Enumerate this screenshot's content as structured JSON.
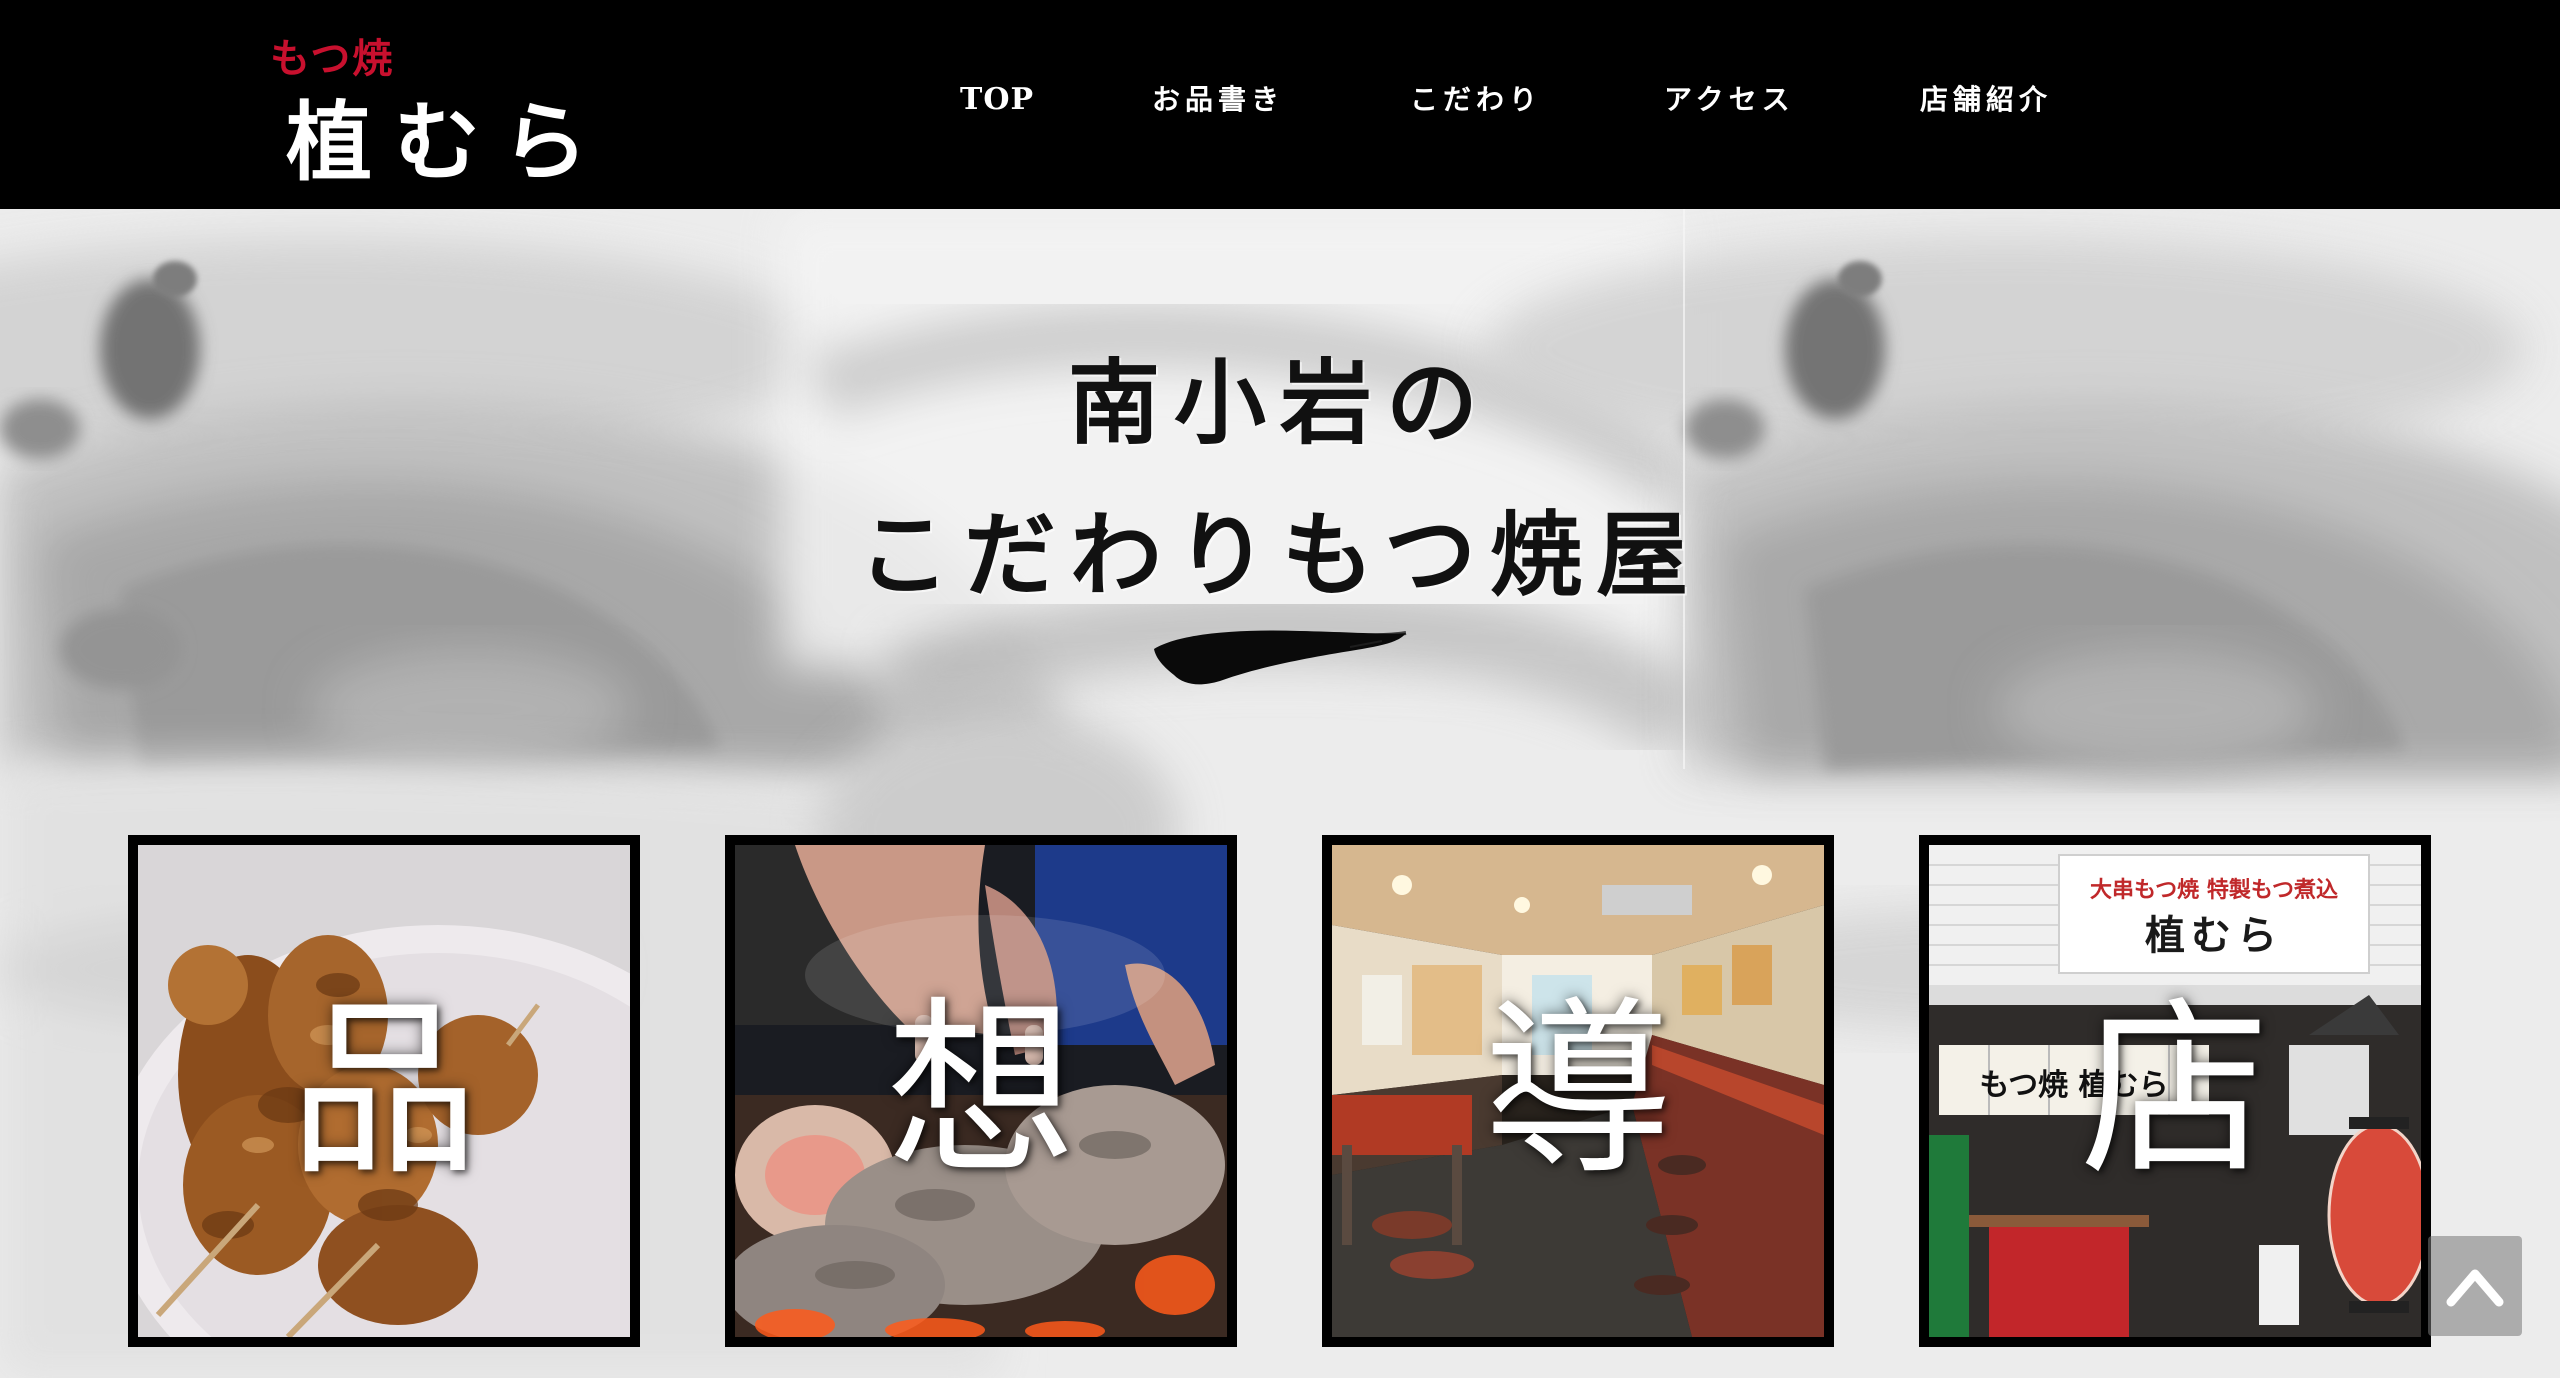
{
  "logo": {
    "sub": "もつ焼",
    "main": "植むら"
  },
  "nav": {
    "items": [
      {
        "label": "TOP"
      },
      {
        "label": "お品書き"
      },
      {
        "label": "こだわり"
      },
      {
        "label": "アクセス"
      },
      {
        "label": "店舗紹介"
      }
    ]
  },
  "hero": {
    "line1": "南小岩の",
    "line2": "こだわりもつ焼屋"
  },
  "cards": [
    {
      "kanji": "品",
      "photo": "grilled-motsu-skewers-on-plate"
    },
    {
      "kanji": "想",
      "photo": "hands-grilling-skewers"
    },
    {
      "kanji": "導",
      "photo": "restaurant-interior-counter"
    },
    {
      "kanji": "店",
      "photo": "shop-front-with-lantern"
    }
  ],
  "shop_photo_text": {
    "sign": "大串もつ焼 特製もつ煮込",
    "sign_name": "植むら",
    "noren": "もつ焼 植むら"
  },
  "colors": {
    "header_bg": "#000000",
    "logo_accent": "#c8102e",
    "nav_text": "#ffffff",
    "hero_text": "#111111",
    "card_border": "#000000"
  },
  "icons": {
    "scroll_top": "chevron-up-icon",
    "divider": "brush-stroke-icon"
  }
}
